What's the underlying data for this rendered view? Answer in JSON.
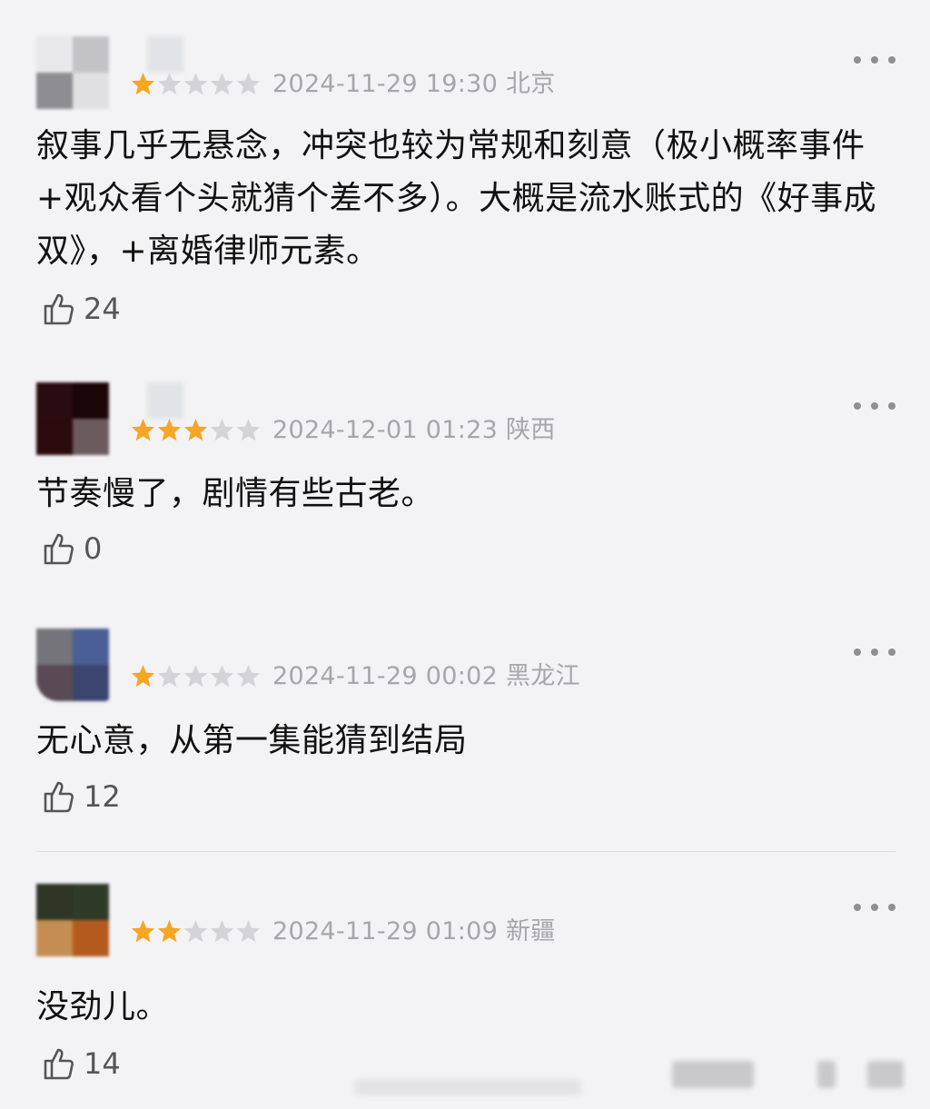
{
  "reviews": [
    {
      "rating": 1,
      "time": "2024-11-29 19:30 北京",
      "text": "叙事几乎无悬念，冲突也较为常规和刻意（极小概率事件+观众看个头就猜个差不多）。大概是流水账式的《好事成双》，+离婚律师元素。",
      "likes": "24",
      "avatar_colors": [
        "#e8e8ea",
        "#c4c4c7",
        "#8e8e92",
        "#e0e0e2"
      ]
    },
    {
      "rating": 3,
      "time": "2024-12-01 01:23 陕西",
      "text": "节奏慢了，剧情有些古老。",
      "likes": "0",
      "avatar_colors": [
        "#2a0b0f",
        "#1a0507",
        "#2b0a0e",
        "#6b5a5e"
      ]
    },
    {
      "rating": 1,
      "time": "2024-11-29 00:02 黑龙江",
      "text": "无心意，从第一集能猜到结局",
      "likes": "12",
      "avatar_colors": [
        "#74747a",
        "#4a5f95",
        "#5a4a55",
        "#3a4570"
      ]
    },
    {
      "rating": 2,
      "time": "2024-11-29 01:09 新疆",
      "text": "没劲儿。",
      "likes": "14",
      "avatar_colors": [
        "#2e3524",
        "#2f3a28",
        "#c48e52",
        "#b45a1e"
      ]
    }
  ],
  "icons": {
    "star": "star-icon",
    "more": "more-dots-icon",
    "like": "thumbs-up-icon"
  },
  "colors": {
    "star_filled": "#f5a623",
    "star_empty": "#d4d4d8",
    "meta": "#a6a6ab",
    "background": "#f3f3f5"
  }
}
